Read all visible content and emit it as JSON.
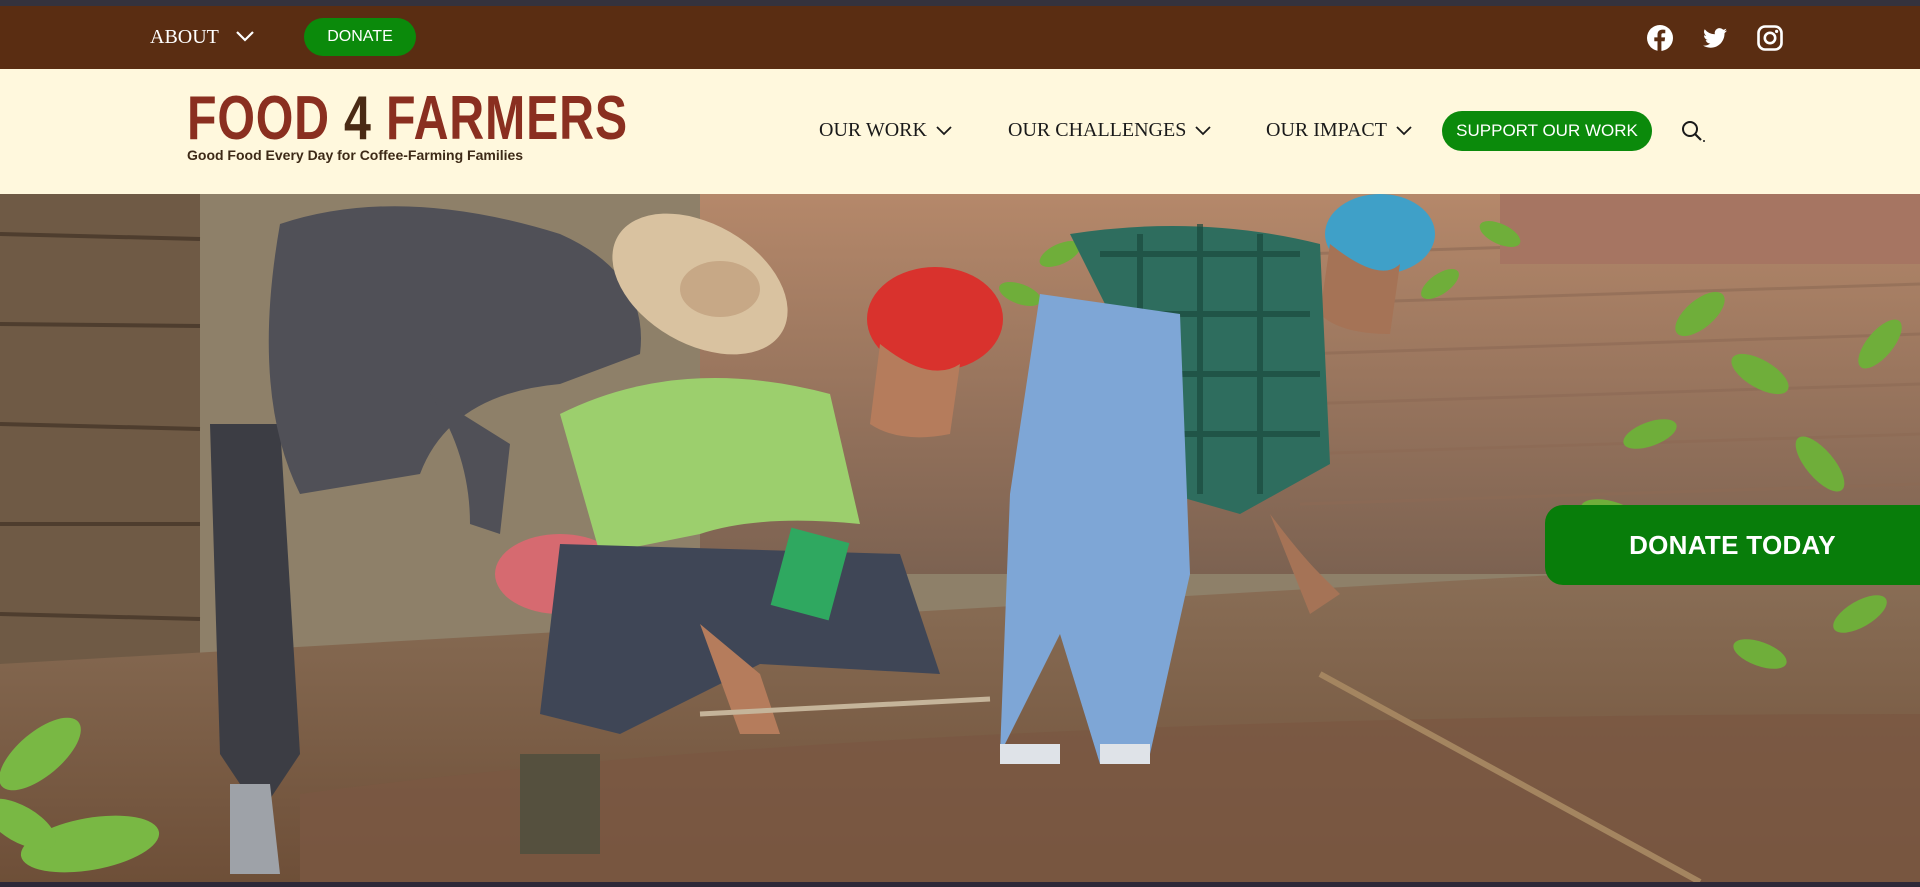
{
  "topbar": {
    "about_label": "ABOUT",
    "donate_label": "DONATE",
    "socials": [
      "facebook-icon",
      "twitter-icon",
      "instagram-icon"
    ]
  },
  "header": {
    "logo_text_left": "FOOD",
    "logo_text_number": "4",
    "logo_text_right": "FARMERS",
    "logo_tagline": "Good Food Every Day for Coffee-Farming Families",
    "nav": [
      {
        "label": "OUR WORK"
      },
      {
        "label": "OUR CHALLENGES"
      },
      {
        "label": "OUR IMPACT"
      }
    ],
    "support_label": "SUPPORT OUR WORK"
  },
  "hero": {
    "donate_today_label": "DONATE TODAY"
  },
  "colors": {
    "topbar_bg": "#5a2d12",
    "header_bg": "#fff8dd",
    "accent_green": "#0b8a0b",
    "logo_red": "#8a2f20"
  }
}
